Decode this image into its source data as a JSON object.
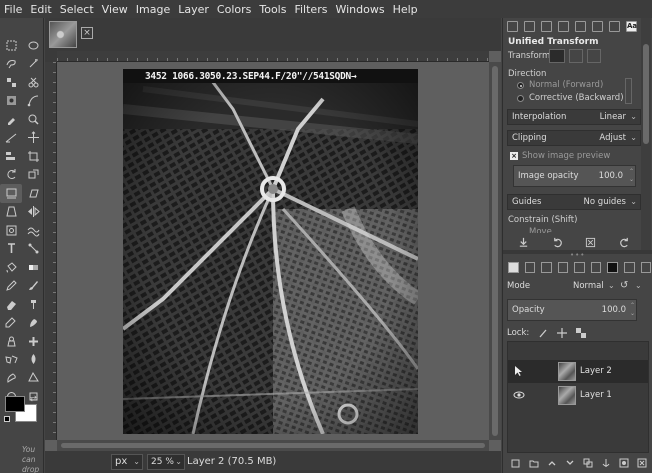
{
  "menubar": {
    "items": [
      "File",
      "Edit",
      "Select",
      "View",
      "Image",
      "Layer",
      "Colors",
      "Tools",
      "Filters",
      "Windows",
      "Help"
    ]
  },
  "toolbox": {
    "tools": [
      "rect-select-icon",
      "ellipse-select-icon",
      "lasso-icon",
      "fuzzy-select-icon",
      "by-color-select-icon",
      "scissors-icon",
      "foreground-select-icon",
      "paths-icon",
      "color-picker-icon",
      "zoom-icon",
      "measure-icon",
      "move-icon",
      "align-icon",
      "crop-icon",
      "rotate-icon",
      "scale-icon",
      "unified-transform-icon",
      "shear-icon",
      "perspective-icon",
      "flip-icon",
      "cage-icon",
      "warp-icon",
      "text-icon",
      "handle-transform-icon",
      "bucket-fill-icon",
      "gradient-icon",
      "pencil-icon",
      "paintbrush-icon",
      "eraser-icon",
      "airbrush-icon",
      "ink-icon",
      "mypaint-icon",
      "clone-icon",
      "heal-icon",
      "perspective-clone-icon",
      "blur-icon",
      "smudge-icon",
      "dodge-burn-icon",
      "extra-icon",
      "extra2-icon"
    ],
    "tip_text": "You can drop dockable dialogs",
    "fg_color": "#000000",
    "bg_color": "#ffffff"
  },
  "image": {
    "caption": "3452   1066.3050.23.SEP44.F/20\"//541SQDN→"
  },
  "statusbar": {
    "unit": "px",
    "zoom": "25 %",
    "layer_info": "Layer 2 (70.5 MB)"
  },
  "tool_options": {
    "title": "Unified Transform",
    "transform_label": "Transform:",
    "direction_label": "Direction",
    "direction_forward": "Normal (Forward)",
    "direction_backward": "Corrective (Backward)",
    "interpolation_label": "Interpolation",
    "interpolation_value": "Linear",
    "clipping_label": "Clipping",
    "clipping_value": "Adjust",
    "show_preview_label": "Show image preview",
    "image_opacity_label": "Image opacity",
    "image_opacity_value": "100.0",
    "guides_label": "Guides",
    "guides_value": "No guides",
    "constrain_label": "Constrain (Shift)",
    "move_label": "Move"
  },
  "layers": {
    "mode_label": "Mode",
    "mode_value": "Normal",
    "opacity_label": "Opacity",
    "opacity_value": "100.0",
    "lock_label": "Lock:",
    "items": [
      {
        "name": "Layer 2",
        "visible": false,
        "selected": true
      },
      {
        "name": "Layer 1",
        "visible": true,
        "selected": false
      }
    ]
  }
}
